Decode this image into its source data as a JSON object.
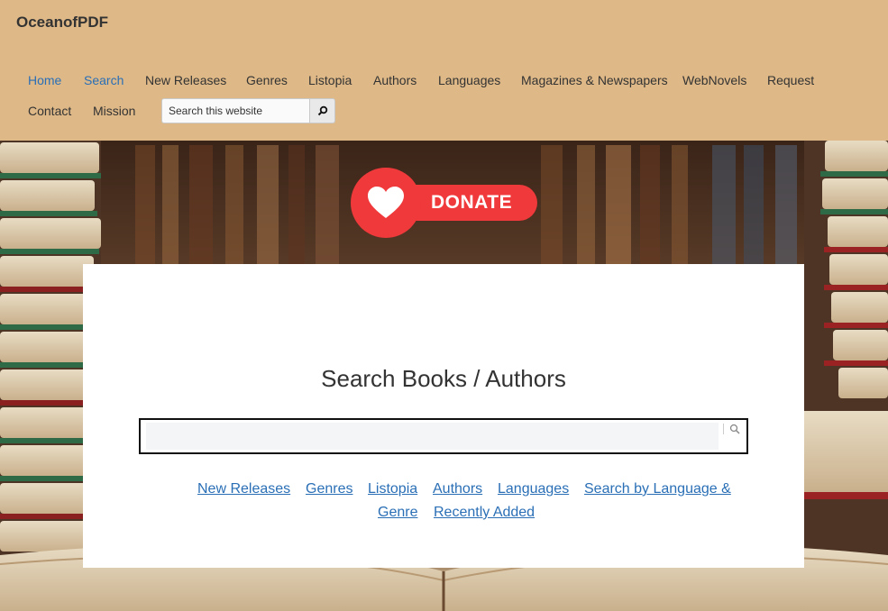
{
  "header": {
    "site_title": "OceanofPDF",
    "nav_row1": [
      "Home",
      "Search",
      "New Releases",
      "Genres",
      "Listopia",
      "Authors",
      "Languages",
      "Magazines & Newspapers",
      "WebNovels",
      "Request"
    ],
    "nav_row2": [
      "Contact",
      "Mission"
    ],
    "search_value": "Search this website"
  },
  "donate": {
    "label": "DONATE"
  },
  "main": {
    "title": "Search Books / Authors",
    "search_value": "",
    "links": {
      "new_releases": "New Releases",
      "genres": "Genres",
      "listopia": "Listopia",
      "authors": "Authors",
      "languages": "Languages",
      "search_by_language": "Search by Language &",
      "genre": "Genre",
      "recently_added": "Recently Added"
    }
  },
  "colors": {
    "header_bg": "#deb887",
    "link": "#2a6fb6",
    "donate": "#f0393b"
  }
}
